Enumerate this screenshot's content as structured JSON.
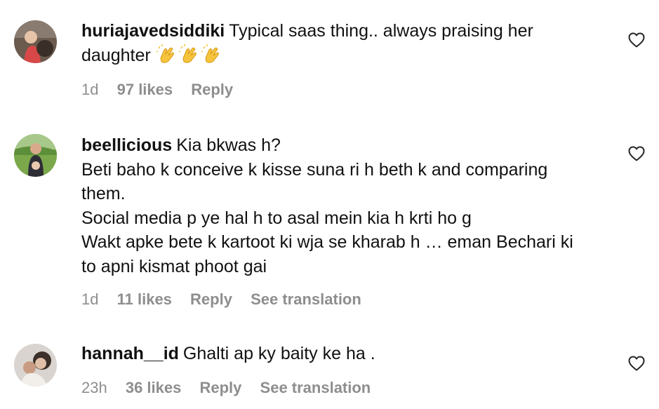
{
  "comments": [
    {
      "username": "huriajavedsiddiki",
      "lines": [
        "Typical saas thing.. always praising her",
        "daughter"
      ],
      "emoji": [
        "clapping-hands-emoji",
        "clapping-hands-emoji",
        "clapping-hands-emoji"
      ],
      "time": "1d",
      "likes": "97 likes",
      "reply": "Reply"
    },
    {
      "username": "beellicious",
      "lines": [
        "Kia bkwas h?",
        "Beti baho k conceive k kisse suna ri h beth k and comparing",
        "them.",
        "Social media p ye hal h to asal mein kia h krti ho g",
        "Wakt apke bete k kartoot ki wja se kharab h … eman Bechari ki",
        "to apni kismat phoot gai"
      ],
      "time": "1d",
      "likes": "11 likes",
      "reply": "Reply",
      "translate": "See translation"
    },
    {
      "username": "hannah__id",
      "lines": [
        "Ghalti ap ky baity ke ha ."
      ],
      "time": "23h",
      "likes": "36 likes",
      "reply": "Reply",
      "translate": "See translation"
    }
  ],
  "icons": {
    "like": "heart-outline-icon"
  },
  "colors": {
    "text": "#111111",
    "meta": "#8e8e8e",
    "background": "#ffffff"
  }
}
